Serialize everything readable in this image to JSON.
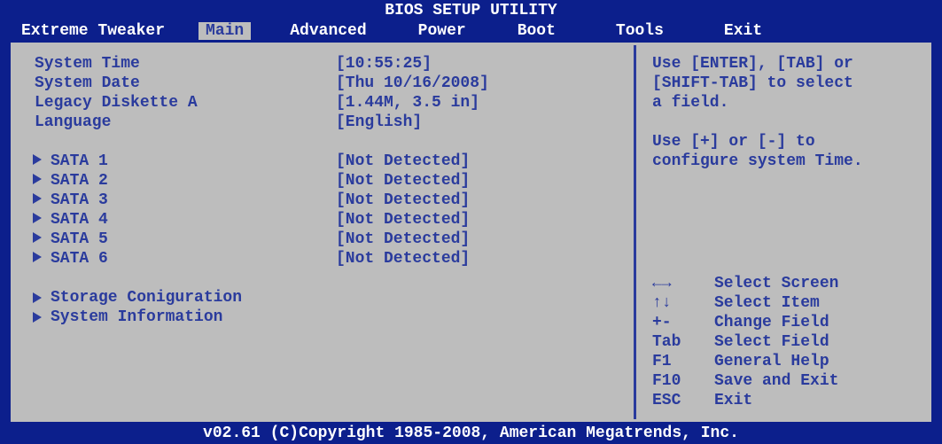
{
  "title": "BIOS SETUP UTILITY",
  "menu": {
    "items": [
      "Extreme Tweaker",
      "Main",
      "Advanced",
      "Power",
      "Boot",
      "Tools",
      "Exit"
    ],
    "active_index": 1
  },
  "main": {
    "rows": [
      {
        "label": "System Time",
        "value": "[10:55:25]"
      },
      {
        "label": "System Date",
        "value": "[Thu 10/16/2008]"
      },
      {
        "label": "Legacy Diskette A",
        "value": "[1.44M, 3.5 in]"
      },
      {
        "label": "Language",
        "value": "[English]"
      }
    ],
    "sata": [
      {
        "label": "SATA 1",
        "value": "[Not Detected]"
      },
      {
        "label": "SATA 2",
        "value": "[Not Detected]"
      },
      {
        "label": "SATA 3",
        "value": "[Not Detected]"
      },
      {
        "label": "SATA 4",
        "value": "[Not Detected]"
      },
      {
        "label": "SATA 5",
        "value": "[Not Detected]"
      },
      {
        "label": "SATA 6",
        "value": "[Not Detected]"
      }
    ],
    "submenus": [
      "Storage Coniguration",
      "System Information"
    ]
  },
  "help": {
    "text1": "Use [ENTER], [TAB] or",
    "text2": "[SHIFT-TAB] to select",
    "text3": "a field.",
    "text4": "Use [+] or [-] to",
    "text5": "configure system Time.",
    "keys": [
      {
        "key": "←→",
        "desc": "Select Screen"
      },
      {
        "key": "↑↓",
        "desc": "Select Item"
      },
      {
        "key": "+-",
        "desc": "Change Field"
      },
      {
        "key": "Tab",
        "desc": "Select Field"
      },
      {
        "key": "F1",
        "desc": "General Help"
      },
      {
        "key": "F10",
        "desc": "Save and Exit"
      },
      {
        "key": "ESC",
        "desc": "Exit"
      }
    ]
  },
  "footer": "v02.61 (C)Copyright 1985-2008, American Megatrends, Inc."
}
